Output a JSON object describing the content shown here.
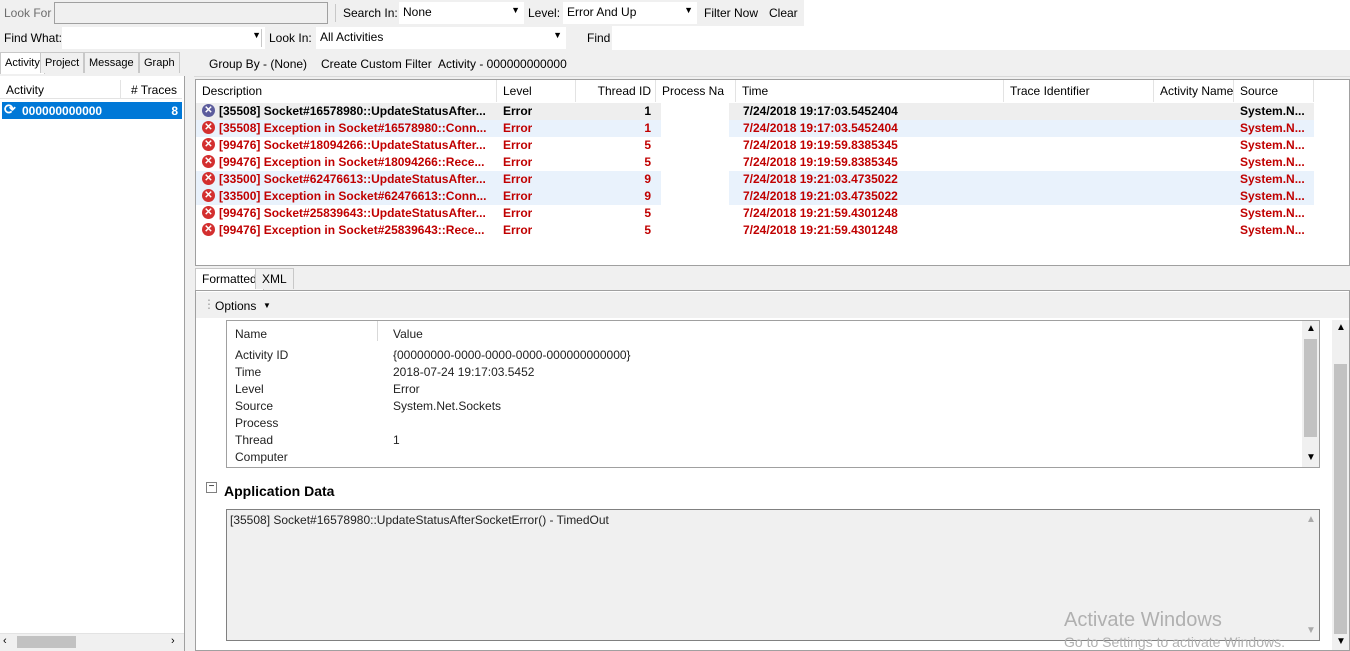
{
  "toolbar": {
    "look_for_label": "Look For",
    "look_for_value": "",
    "search_in_label": "Search In:",
    "search_in_value": "None",
    "level_label": "Level:",
    "level_value": "Error And Up",
    "filter_now": "Filter Now",
    "clear": "Clear",
    "find_what_label": "Find What:",
    "find_what_value": "",
    "look_in_label": "Look In:",
    "look_in_value": "All Activities",
    "find": "Find",
    "group_by": "Group By - (None)",
    "create_custom_filter": "Create Custom Filter",
    "activity_filter": "Activity - 000000000000"
  },
  "left_panel": {
    "tabs": [
      "Activity",
      "Project",
      "Message",
      "Graph"
    ],
    "columns": [
      "Activity",
      "# Traces"
    ],
    "rows": [
      {
        "name": "000000000000",
        "traces": "8"
      }
    ]
  },
  "grid": {
    "columns": [
      "Description",
      "Level",
      "Thread ID",
      "Process Na",
      "Time",
      "Trace Identifier",
      "Activity Name",
      "Source"
    ],
    "rows": [
      {
        "desc": "[35508] Socket#16578980::UpdateStatusAfter...",
        "level": "Error",
        "thread": "1",
        "time": "7/24/2018 19:17:03.5452404",
        "source": "System.N..."
      },
      {
        "desc": "[35508] Exception in Socket#16578980::Conn...",
        "level": "Error",
        "thread": "1",
        "time": "7/24/2018 19:17:03.5452404",
        "source": "System.N..."
      },
      {
        "desc": "[99476] Socket#18094266::UpdateStatusAfter...",
        "level": "Error",
        "thread": "5",
        "time": "7/24/2018 19:19:59.8385345",
        "source": "System.N..."
      },
      {
        "desc": "[99476] Exception in Socket#18094266::Rece...",
        "level": "Error",
        "thread": "5",
        "time": "7/24/2018 19:19:59.8385345",
        "source": "System.N..."
      },
      {
        "desc": "[33500] Socket#62476613::UpdateStatusAfter...",
        "level": "Error",
        "thread": "9",
        "time": "7/24/2018 19:21:03.4735022",
        "source": "System.N..."
      },
      {
        "desc": "[33500] Exception in Socket#62476613::Conn...",
        "level": "Error",
        "thread": "9",
        "time": "7/24/2018 19:21:03.4735022",
        "source": "System.N..."
      },
      {
        "desc": "[99476] Socket#25839643::UpdateStatusAfter...",
        "level": "Error",
        "thread": "5",
        "time": "7/24/2018 19:21:59.4301248",
        "source": "System.N..."
      },
      {
        "desc": "[99476] Exception in Socket#25839643::Rece...",
        "level": "Error",
        "thread": "5",
        "time": "7/24/2018 19:21:59.4301248",
        "source": "System.N..."
      }
    ]
  },
  "detail": {
    "tabs": [
      "Formatted",
      "XML"
    ],
    "options": "Options",
    "props_header": {
      "name": "Name",
      "value": "Value"
    },
    "props": [
      {
        "name": "Activity ID",
        "value": "{00000000-0000-0000-0000-000000000000}"
      },
      {
        "name": "Time",
        "value": "2018-07-24 19:17:03.5452"
      },
      {
        "name": "Level",
        "value": "Error"
      },
      {
        "name": "Source",
        "value": "System.Net.Sockets"
      },
      {
        "name": "Process",
        "value": ""
      },
      {
        "name": "Thread",
        "value": "1"
      },
      {
        "name": "Computer",
        "value": ""
      }
    ],
    "app_data_title": "Application Data",
    "app_data_text": "[35508] Socket#16578980::UpdateStatusAfterSocketError() - TimedOut"
  },
  "watermark": {
    "line1": "Activate Windows",
    "line2": "Go to Settings to activate Windows."
  },
  "colors": {
    "error_text": "#c00000",
    "selection": "#0078d7",
    "alt_row": "#e9f2fc"
  }
}
